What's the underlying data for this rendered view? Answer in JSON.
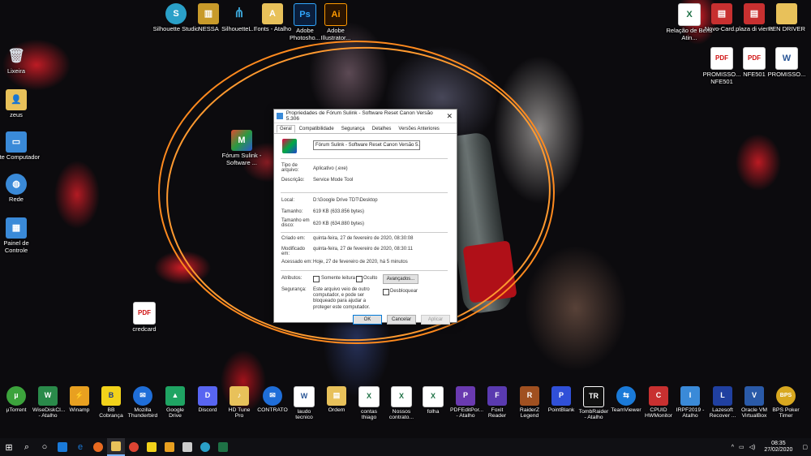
{
  "desktop_icons": [
    {
      "label": "Silhouette Studio",
      "icon": "silhouette-icon",
      "color": "#2aa0c8"
    },
    {
      "label": "NESSA",
      "icon": "archive-icon",
      "color": "#c89a2a"
    },
    {
      "label": "SilhouetteL...",
      "icon": "silhouette-connect-icon",
      "color": "#3aa0d0"
    },
    {
      "label": "Fonts - Atalho",
      "icon": "fonts-folder-icon",
      "color": "#e8c15a"
    },
    {
      "label": "Adobe Photosho...",
      "icon": "photoshop-icon",
      "color": "#0a1e3c"
    },
    {
      "label": "Adobe Illustrator...",
      "icon": "illustrator-icon",
      "color": "#2a1400"
    },
    {
      "label": "Lixeira",
      "icon": "recycle-bin-icon",
      "color": "#d8dde4"
    },
    {
      "label": "zeus",
      "icon": "user-folder-icon",
      "color": "#e8c15a"
    },
    {
      "label": "Este Computador",
      "icon": "computer-icon",
      "color": "#3a8ad8"
    },
    {
      "label": "Rede",
      "icon": "network-icon",
      "color": "#3a8ad8"
    },
    {
      "label": "Painel de Controle",
      "icon": "control-panel-icon",
      "color": "#3a8ad8"
    },
    {
      "label": "Fórum Sulink - Software ...",
      "icon": "app-icon",
      "color": "#e04a30"
    },
    {
      "label": "credcard",
      "icon": "pdf-icon",
      "color": "#d01010"
    },
    {
      "label": "Relação de Bens Atin...",
      "icon": "excel-icon",
      "color": "#1e7145"
    },
    {
      "label": "Novo-Card...",
      "icon": "zip-icon",
      "color": "#c83030"
    },
    {
      "label": "plaza di viena",
      "icon": "zip-icon",
      "color": "#c83030"
    },
    {
      "label": "PEN DRIVER",
      "icon": "folder-icon",
      "color": "#e8c15a"
    },
    {
      "label": "PROMISSO... NFE501",
      "icon": "pdf-icon",
      "color": "#d01010"
    },
    {
      "label": "NFE501",
      "icon": "pdf-icon",
      "color": "#d01010"
    },
    {
      "label": "PROMISSO...",
      "icon": "word-icon",
      "color": "#2b5797"
    }
  ],
  "dialog": {
    "title": "Propriedades de Fórum Sulink - Software Reset Canon Versão 5.306",
    "tabs": [
      "Geral",
      "Compatibilidade",
      "Segurança",
      "Detalhes",
      "Versões Anteriores"
    ],
    "filename": "Fórum Sulink - Software Reset Canon Versão 5.306",
    "fields": {
      "tipo_label": "Tipo de arquivo:",
      "tipo": "Aplicativo (.exe)",
      "desc_label": "Descrição:",
      "desc": "Service Mode Tool",
      "local_label": "Local:",
      "local": "D:\\Google Drive TDT\\Desktop",
      "tamanho_label": "Tamanho:",
      "tamanho": "619 KB (633.856 bytes)",
      "disco_label": "Tamanho em disco:",
      "disco": "620 KB (634.880 bytes)",
      "criado_label": "Criado em:",
      "criado": "quinta-feira, 27 de fevereiro de 2020, 08:30:08",
      "modificado_label": "Modificado em:",
      "modificado": "quinta-feira, 27 de fevereiro de 2020, 08:30:11",
      "acessado_label": "Acessado em:",
      "acessado": "Hoje, 27 de fevereiro de 2020, há 5 minutos",
      "atributos_label": "Atributos:",
      "somente_leitura": "Somente leitura",
      "oculto": "Oculto",
      "avancados": "Avançados...",
      "seguranca_label": "Segurança:",
      "seguranca": "Este arquivo veio de outro computador, e pode ser bloqueado para ajudar a proteger este computador.",
      "desbloquear": "Desbloquear"
    },
    "buttons": {
      "ok": "OK",
      "cancel": "Cancelar",
      "apply": "Aplicar"
    }
  },
  "dock": [
    {
      "label": "µTorrent",
      "color": "#3ca33c",
      "glyph": "µ"
    },
    {
      "label": "WiseDiskCl... - Atalho",
      "color": "#2a8a4a",
      "glyph": "W"
    },
    {
      "label": "Winamp",
      "color": "#e8a020",
      "glyph": "⚡"
    },
    {
      "label": "BB Cobrança",
      "color": "#f2d21a",
      "glyph": "B"
    },
    {
      "label": "Mozilla Thunderbird",
      "color": "#1f6ed8",
      "glyph": "✉"
    },
    {
      "label": "Google Drive",
      "color": "#1fa463",
      "glyph": "▲"
    },
    {
      "label": "Discord",
      "color": "#5865f2",
      "glyph": "D"
    },
    {
      "label": "HD Tune Pro",
      "color": "#e8c15a",
      "glyph": "♪"
    },
    {
      "label": "CONTRATO",
      "color": "#1f6ed8",
      "glyph": "✉"
    },
    {
      "label": "laudo tecnico",
      "color": "#2b5797",
      "glyph": "W"
    },
    {
      "label": "Ordem",
      "color": "#e8c15a",
      "glyph": "▤"
    },
    {
      "label": "contas thiago",
      "color": "#1e7145",
      "glyph": "X"
    },
    {
      "label": "Nossos contrato...",
      "color": "#1e7145",
      "glyph": "X"
    },
    {
      "label": "folha",
      "color": "#1e7145",
      "glyph": "X"
    },
    {
      "label": "PDFEditPor... - Atalho",
      "color": "#6a3ab0",
      "glyph": "P"
    },
    {
      "label": "Foxit Reader",
      "color": "#5a3ab0",
      "glyph": "F"
    },
    {
      "label": "RaiderZ Legend",
      "color": "#a05020",
      "glyph": "R"
    },
    {
      "label": "PointBlank",
      "color": "#3050d8",
      "glyph": "P"
    },
    {
      "label": "TombRaider - Atalho",
      "color": "#111111",
      "glyph": "TR"
    },
    {
      "label": "TeamViewer",
      "color": "#1a7ad8",
      "glyph": "⇆"
    },
    {
      "label": "CPUID HWMonitor",
      "color": "#c83030",
      "glyph": "C"
    },
    {
      "label": "IRPF2019 - Atalho",
      "color": "#3a8ad8",
      "glyph": "I"
    },
    {
      "label": "Lazesoft Recover ...",
      "color": "#2040a0",
      "glyph": "L"
    },
    {
      "label": "Oracle VM VirtualBox",
      "color": "#2a5aa8",
      "glyph": "V"
    },
    {
      "label": "BPS Poker Timer",
      "color": "#d8a820",
      "glyph": "BPS"
    }
  ],
  "taskbar": {
    "time": "08:35",
    "date": "27/02/2020",
    "apps": [
      {
        "name": "start",
        "color": "#ffffff"
      },
      {
        "name": "search",
        "color": "#ffffff"
      },
      {
        "name": "cortana",
        "color": "#ffffff"
      },
      {
        "name": "task-view",
        "color": "#1a7ad8"
      },
      {
        "name": "edge",
        "color": "#1a7ad8"
      },
      {
        "name": "firefox",
        "color": "#e86a20"
      },
      {
        "name": "explorer",
        "color": "#e8c15a"
      },
      {
        "name": "chrome",
        "color": "#dd4433"
      },
      {
        "name": "notes",
        "color": "#f2d21a"
      },
      {
        "name": "photos",
        "color": "#e8a020"
      },
      {
        "name": "calculator",
        "color": "#cccccc"
      },
      {
        "name": "silhouette",
        "color": "#2aa0c8"
      },
      {
        "name": "excel",
        "color": "#1e7145"
      }
    ]
  }
}
